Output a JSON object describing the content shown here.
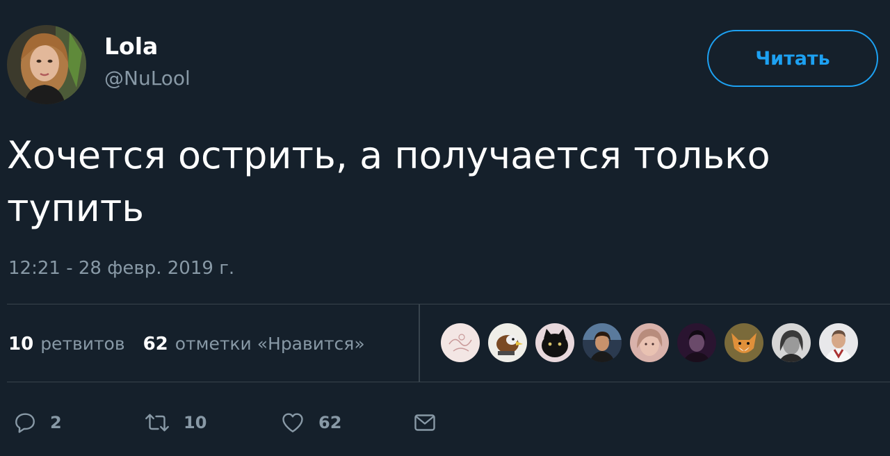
{
  "author": {
    "display_name": "Lola",
    "handle": "@NuLool"
  },
  "follow_button": {
    "label": "Читать"
  },
  "tweet": {
    "text_line1": "Хочется острить, а получается только",
    "text_line2": "тупить",
    "timestamp": "12:21 - 28 февр. 2019 г."
  },
  "stats": {
    "retweets_count": "10",
    "retweets_label": "ретвитов",
    "likes_count": "62",
    "likes_label": "отметки «Нравится»"
  },
  "likers": [
    {
      "icon": "liker-avatar-sketch"
    },
    {
      "icon": "liker-avatar-bird"
    },
    {
      "icon": "liker-avatar-cat"
    },
    {
      "icon": "liker-avatar-person"
    },
    {
      "icon": "liker-avatar-girl"
    },
    {
      "icon": "liker-avatar-man"
    },
    {
      "icon": "liker-avatar-fox"
    },
    {
      "icon": "liker-avatar-woman"
    },
    {
      "icon": "liker-avatar-doctor"
    }
  ],
  "actions": {
    "reply_count": "2",
    "retweet_count": "10",
    "like_count": "62"
  },
  "colors": {
    "background": "#15202b",
    "accent": "#1da1f2",
    "muted": "#8899a6",
    "divider": "#38444d"
  }
}
